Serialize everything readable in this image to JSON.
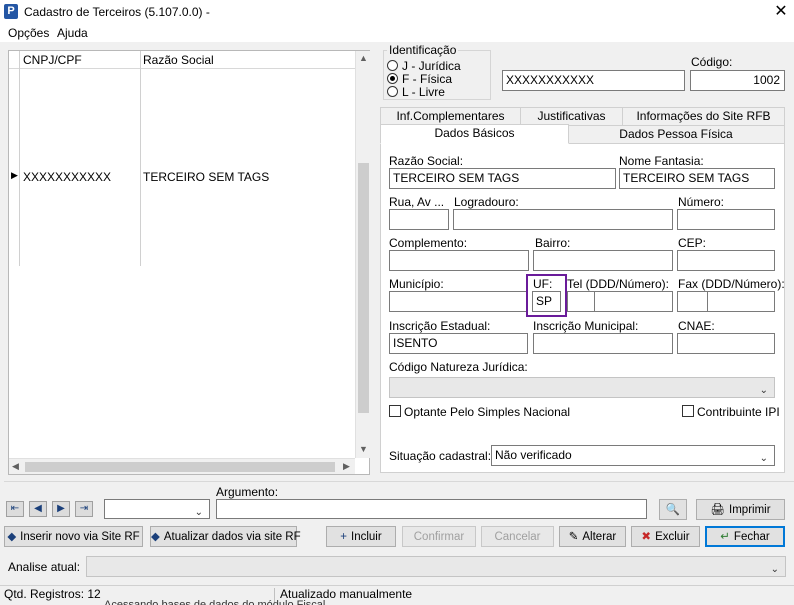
{
  "window": {
    "title": "Cadastro de Terceiros (5.107.0.0) -",
    "app_icon": "P",
    "close_glyph": "✕"
  },
  "menu": [
    "Opções",
    "Ajuda"
  ],
  "grid": {
    "columns": [
      "CNPJ/CPF",
      "Razão Social"
    ],
    "rows": [
      {
        "cnpj": "XXXXXXXXXXX",
        "razao": "TERCEIRO SEM TAGS",
        "current": true
      }
    ],
    "row_pointer": "▶"
  },
  "identificacao": {
    "label": "Identificação",
    "options": [
      {
        "label": "J - Jurídica",
        "checked": false
      },
      {
        "label": "F - Física",
        "checked": true
      },
      {
        "label": "L - Livre",
        "checked": false
      }
    ],
    "document_value": "XXXXXXXXXXX"
  },
  "codigo": {
    "label": "Código:",
    "value": "1002"
  },
  "tabs": {
    "top_row": [
      "Inf.Complementares",
      "Justificativas",
      "Informações do Site RFB"
    ],
    "bottom_row": [
      "Dados Básicos",
      "Dados Pessoa Física"
    ],
    "active": "Dados Básicos"
  },
  "form": {
    "razao_social": {
      "label": "Razão Social:",
      "value": "TERCEIRO SEM TAGS"
    },
    "nome_fantasia": {
      "label": "Nome Fantasia:",
      "value": "TERCEIRO SEM TAGS"
    },
    "rua": {
      "label": "Rua, Av ...",
      "value": ""
    },
    "logradouro": {
      "label": "Logradouro:",
      "value": ""
    },
    "numero": {
      "label": "Número:",
      "value": ""
    },
    "complemento": {
      "label": "Complemento:",
      "value": ""
    },
    "bairro": {
      "label": "Bairro:",
      "value": ""
    },
    "cep": {
      "label": "CEP:",
      "value": ""
    },
    "municipio": {
      "label": "Município:",
      "value": ""
    },
    "uf": {
      "label": "UF:",
      "value": "SP"
    },
    "tel": {
      "label": "Tel (DDD/Número):",
      "value": ""
    },
    "fax": {
      "label": "Fax (DDD/Número):",
      "value": ""
    },
    "inscricao_estadual": {
      "label": "Inscrição Estadual:",
      "value": "ISENTO"
    },
    "inscricao_municipal": {
      "label": "Inscrição Municipal:",
      "value": ""
    },
    "cnae": {
      "label": "CNAE:",
      "value": ""
    },
    "codigo_natureza": {
      "label": "Código Natureza Jurídica:",
      "value": ""
    },
    "optante_simples": {
      "label": "Optante Pelo Simples Nacional",
      "checked": false
    },
    "contribuinte_ipi": {
      "label": "Contribuinte IPI",
      "checked": false
    },
    "situacao": {
      "label": "Situação cadastral:",
      "value": "Não verificado"
    }
  },
  "search": {
    "label": "Argumento:",
    "value": ""
  },
  "buttons": {
    "imprimir": "Imprimir",
    "inserir_rf": "Inserir novo via Site RF",
    "atualizar_rf": "Atualizar dados via site RF",
    "incluir": "Incluir",
    "confirmar": "Confirmar",
    "cancelar": "Cancelar",
    "alterar": "Alterar",
    "excluir": "Excluir",
    "fechar": "Fechar"
  },
  "analise": {
    "label": "Analise atual:",
    "value": ""
  },
  "status": {
    "registros": "Qtd. Registros: 12",
    "atualizacao": "Atualizado manualmente",
    "hidden_text": "Acessando bases de dados do módulo Fiscal..."
  },
  "colors": {
    "highlight_border": "#6a1b9a",
    "default_button_border": "#0078d7"
  }
}
